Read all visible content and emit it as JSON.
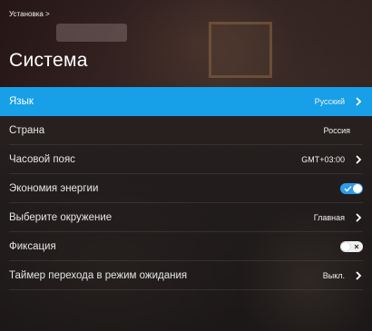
{
  "breadcrumb": "Установка >",
  "title": "Система",
  "menu": {
    "language": {
      "label": "Язык",
      "value": "Русский"
    },
    "country": {
      "label": "Страна",
      "value": "Россия"
    },
    "timezone": {
      "label": "Часовой пояс",
      "value": "GMT+03:00"
    },
    "energy_saving": {
      "label": "Экономия энергии",
      "state": "on"
    },
    "environment": {
      "label": "Выберите окружение",
      "value": "Главная"
    },
    "lock": {
      "label": "Фиксация",
      "state": "off"
    },
    "standby_timer": {
      "label": "Таймер перехода в режим ожидания",
      "value": "Выкл."
    }
  },
  "colors": {
    "accent": "#179fe8",
    "toggle_on": "#2f9be6"
  },
  "icons": {
    "chevron": "chevron-right-icon",
    "check": "check-icon",
    "close": "close-icon"
  }
}
